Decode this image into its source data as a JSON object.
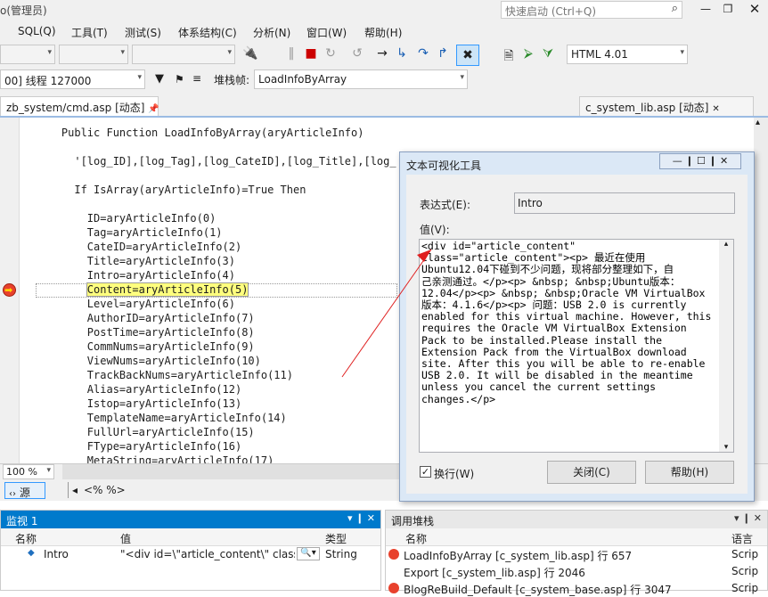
{
  "window": {
    "title": "o(管理员)",
    "quick_launch": "快速启动 (Ctrl+Q)"
  },
  "menu": [
    "SQL(Q)",
    "工具(T)",
    "测试(S)",
    "体系结构(C)",
    "分析(N)",
    "窗口(W)",
    "帮助(H)"
  ],
  "toolbar": {
    "doc_type": "HTML 4.01",
    "thread": "00] 线程 127000",
    "stack_label": "堆栈帧:",
    "stack_frame": "LoadInfoByArray"
  },
  "tabs": [
    {
      "label": "zb_system/cmd.asp [动态]"
    },
    {
      "label": "c_system_lib.asp [动态]"
    }
  ],
  "code": {
    "lines": [
      {
        "indent": "    ",
        "text": "Public Function LoadInfoByArray(aryArticleInfo)",
        "kind": "func"
      },
      {
        "indent": "      ",
        "text": "'[log_ID],[log_Tag],[log_CateID],[log_Title],[log_",
        "kind": "comment"
      },
      {
        "indent": "      ",
        "text": "If IsArray(aryArticleInfo)=True Then",
        "kind": "if"
      },
      {
        "indent": "        ",
        "text": "ID=aryArticleInfo(0)",
        "kind": "plain"
      },
      {
        "indent": "        ",
        "text": "Tag=aryArticleInfo(1)",
        "kind": "plain"
      },
      {
        "indent": "        ",
        "text": "CateID=aryArticleInfo(2)",
        "kind": "plain"
      },
      {
        "indent": "        ",
        "text": "Title=aryArticleInfo(3)",
        "kind": "plain"
      },
      {
        "indent": "        ",
        "text": "Intro=aryArticleInfo(4)",
        "kind": "plain"
      },
      {
        "indent": "        ",
        "text": "Content=aryArticleInfo(5)",
        "kind": "current"
      },
      {
        "indent": "        ",
        "text": "Level=aryArticleInfo(6)",
        "kind": "plain"
      },
      {
        "indent": "        ",
        "text": "AuthorID=aryArticleInfo(7)",
        "kind": "plain"
      },
      {
        "indent": "        ",
        "text": "PostTime=aryArticleInfo(8)",
        "kind": "plain"
      },
      {
        "indent": "        ",
        "text": "CommNums=aryArticleInfo(9)",
        "kind": "plain"
      },
      {
        "indent": "        ",
        "text": "ViewNums=aryArticleInfo(10)",
        "kind": "plain"
      },
      {
        "indent": "        ",
        "text": "TrackBackNums=aryArticleInfo(11)",
        "kind": "plain"
      },
      {
        "indent": "        ",
        "text": "Alias=aryArticleInfo(12)",
        "kind": "plain"
      },
      {
        "indent": "        ",
        "text": "Istop=aryArticleInfo(13)",
        "kind": "plain"
      },
      {
        "indent": "        ",
        "text": "TemplateName=aryArticleInfo(14)",
        "kind": "plain"
      },
      {
        "indent": "        ",
        "text": "FullUrl=aryArticleInfo(15)",
        "kind": "plain"
      },
      {
        "indent": "        ",
        "text": "FType=aryArticleInfo(16)",
        "kind": "plain"
      },
      {
        "indent": "        ",
        "text": "MetaString=aryArticleInfo(17)",
        "kind": "plain"
      }
    ]
  },
  "status": {
    "zoom": "100 %",
    "source_button": "源",
    "breadcrumb": "<% %>"
  },
  "watch": {
    "title": "监视 1",
    "columns": [
      "名称",
      "值",
      "类型"
    ],
    "rows": [
      {
        "name": "Intro",
        "value": "\"<div id=\\\"article_content\\\" class=\\\"a",
        "type": "String"
      }
    ]
  },
  "callstack": {
    "title": "调用堆栈",
    "columns": [
      "名称",
      "语言"
    ],
    "rows": [
      {
        "name": "LoadInfoByArray [c_system_lib.asp] 行 657",
        "lang": "Scrip"
      },
      {
        "name": "Export [c_system_lib.asp] 行 2046",
        "lang": "Scrip"
      },
      {
        "name": "BlogReBuild_Default [c_system_base.asp] 行 3047",
        "lang": "Scrip"
      }
    ]
  },
  "dialog": {
    "title": "文本可视化工具",
    "expr_label": "表达式(E):",
    "expr_value": "Intro",
    "value_label": "值(V):",
    "value_text": "<div id=\"article_content\"\nclass=\"article_content\"><p> 最近在使用\nUbuntu12.04下碰到不少问题，现将部分整理如下，自\n己亲测通过。</p><p> &nbsp; &nbsp;Ubuntu版本：\n12.04</p><p> &nbsp; &nbsp;Oracle VM VirtualBox\n版本：4.1.6</p><p> 问题：USB 2.0 is currently\nenabled for this virtual machine. However, this\nrequires the Oracle VM VirtualBox Extension\nPack to be installed.Please install the\nExtension Pack from the VirtualBox download\nsite. After this you will be able to re-enable\nUSB 2.0. It will be disabled in the meantime\nunless you cancel the current settings\nchanges.</p>",
    "wrap_label": "换行(W)",
    "close_label": "关闭(C)",
    "help_label": "帮助(H)"
  },
  "colors": {
    "accent": "#007acc",
    "breakpoint": "#e8412c",
    "highlight": "#ffff7e",
    "arrow": "#e02020"
  }
}
